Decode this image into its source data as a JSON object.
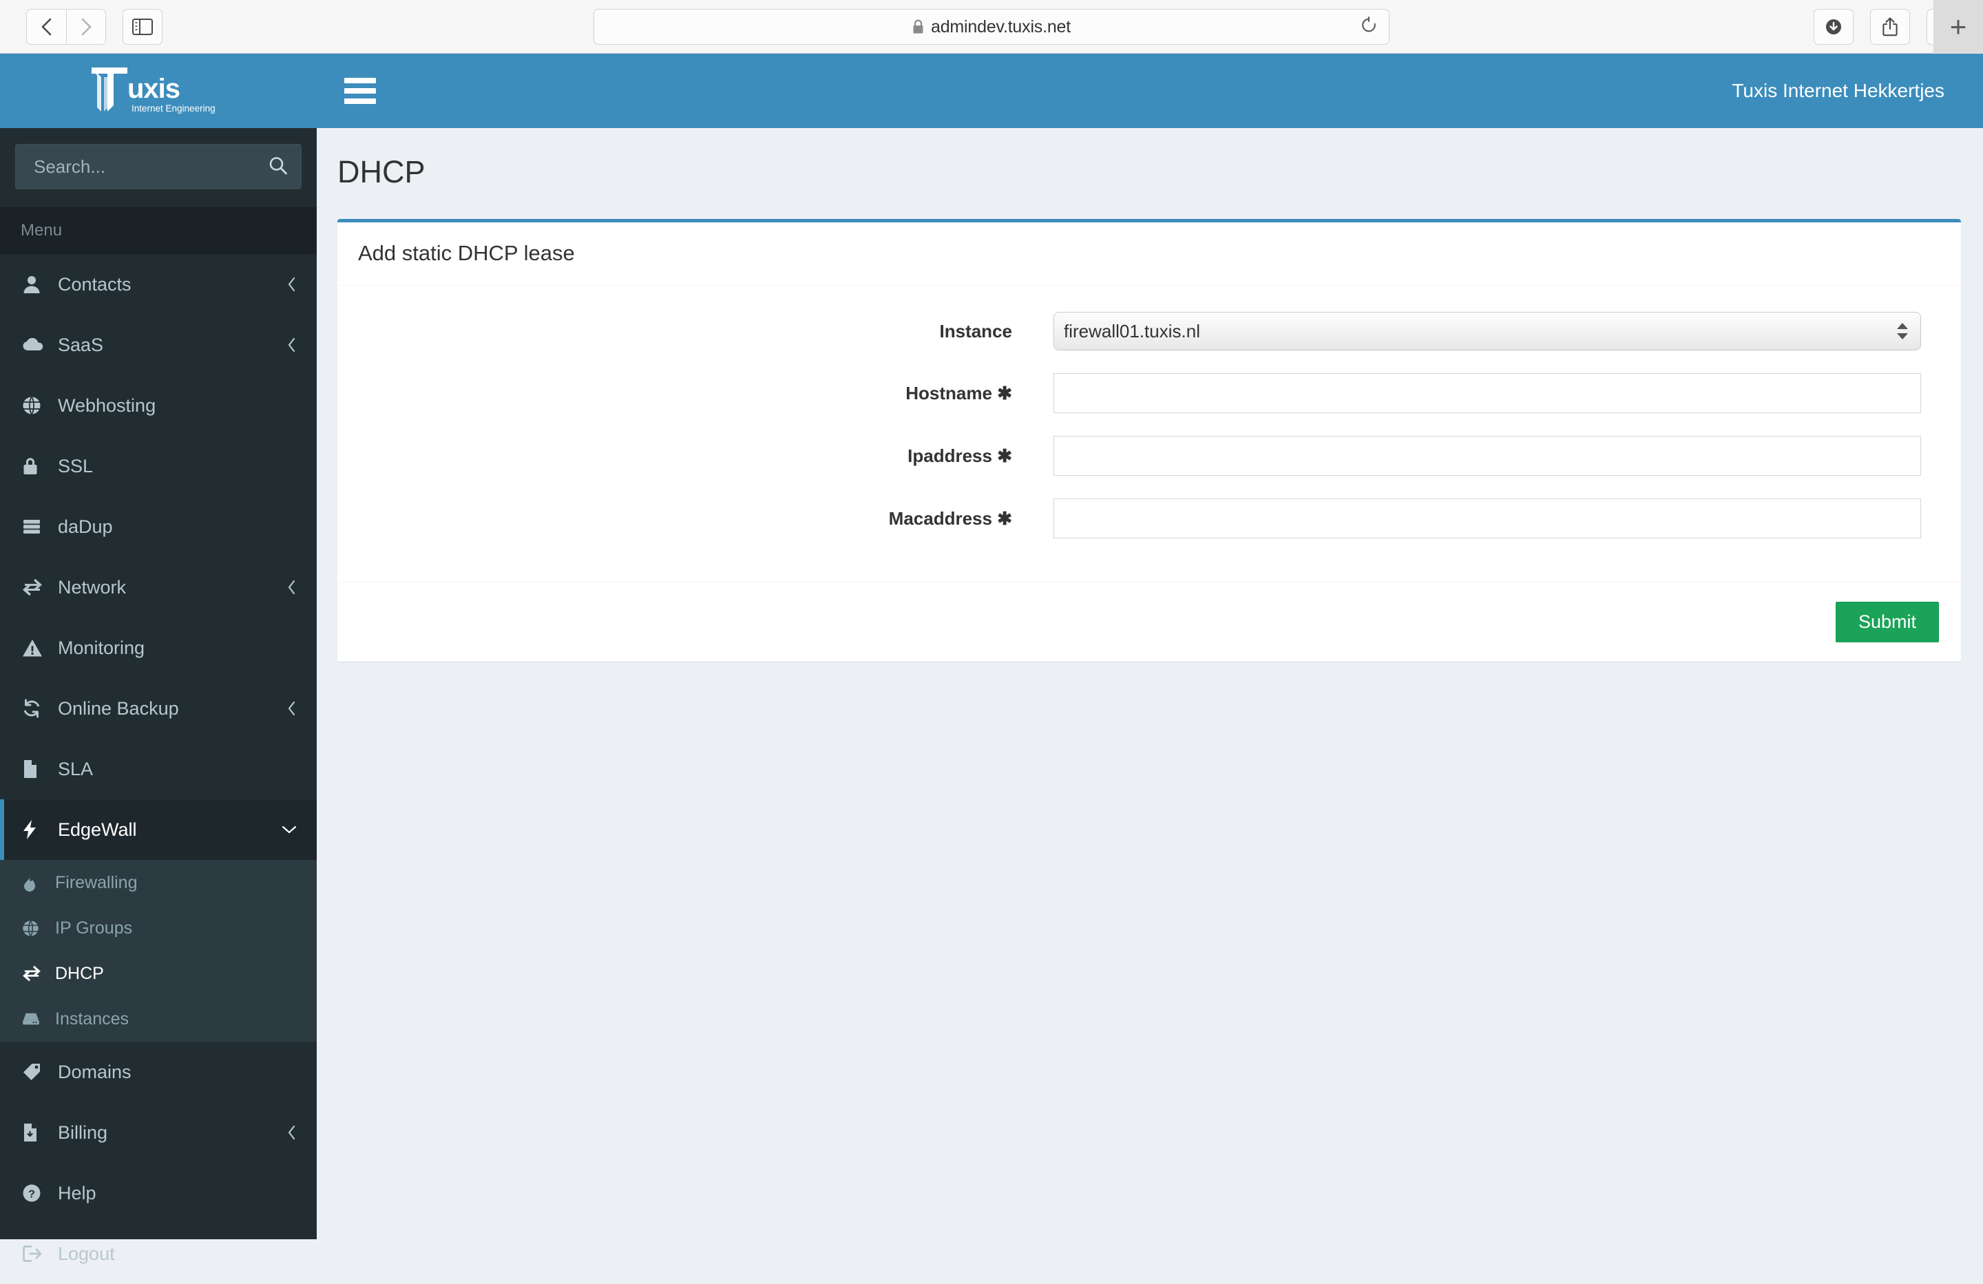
{
  "browser": {
    "url": "admindev.tuxis.net",
    "lock_icon": "lock-icon",
    "back_icon": "chevron-left-icon",
    "forward_icon": "chevron-right-icon",
    "sidebar_toggle_icon": "sidebar-toggle-icon",
    "reload_icon": "reload-icon",
    "downloads_icon": "download-icon",
    "share_icon": "share-icon",
    "tabs_icon": "tab-overview-icon",
    "newtab_label": "+"
  },
  "brand": {
    "name": "Tuxis",
    "tagline": "Internet Engineering",
    "header_color": "#3c8dbc",
    "sidebar_color": "#222d32"
  },
  "topbar": {
    "menu_toggle_icon": "hamburger-icon",
    "user_name": "Tuxis Internet Hekkertjes"
  },
  "sidebar": {
    "search": {
      "placeholder": "Search...",
      "value": "",
      "icon": "search-icon"
    },
    "menu_header": "Menu",
    "items": [
      {
        "label": "Contacts",
        "icon": "user-icon",
        "arrow": "chevron-left-icon",
        "active": false
      },
      {
        "label": "SaaS",
        "icon": "cloud-icon",
        "arrow": "chevron-left-icon",
        "active": false
      },
      {
        "label": "Webhosting",
        "icon": "globe-icon",
        "arrow": "",
        "active": false
      },
      {
        "label": "SSL",
        "icon": "lock-icon",
        "arrow": "",
        "active": false
      },
      {
        "label": "daDup",
        "icon": "server-icon",
        "arrow": "",
        "active": false
      },
      {
        "label": "Network",
        "icon": "exchange-icon",
        "arrow": "chevron-left-icon",
        "active": false
      },
      {
        "label": "Monitoring",
        "icon": "warning-icon",
        "arrow": "",
        "active": false
      },
      {
        "label": "Online Backup",
        "icon": "refresh-icon",
        "arrow": "chevron-left-icon",
        "active": false
      },
      {
        "label": "SLA",
        "icon": "file-icon",
        "arrow": "",
        "active": false
      },
      {
        "label": "EdgeWall",
        "icon": "bolt-icon",
        "arrow": "chevron-down-icon",
        "active": true
      },
      {
        "label": "Domains",
        "icon": "tag-icon",
        "arrow": "",
        "active": false
      },
      {
        "label": "Billing",
        "icon": "file-download-icon",
        "arrow": "chevron-left-icon",
        "active": false
      },
      {
        "label": "Help",
        "icon": "question-circle-icon",
        "arrow": "",
        "active": false
      },
      {
        "label": "Logout",
        "icon": "sign-out-icon",
        "arrow": "",
        "active": false
      }
    ],
    "submenu": [
      {
        "label": "Firewalling",
        "icon": "fire-icon",
        "current": false
      },
      {
        "label": "IP Groups",
        "icon": "globe-icon",
        "current": false
      },
      {
        "label": "DHCP",
        "icon": "exchange-icon",
        "current": true
      },
      {
        "label": "Instances",
        "icon": "server-icon",
        "current": false
      }
    ]
  },
  "main": {
    "page_title": "DHCP",
    "panel": {
      "title": "Add static DHCP lease",
      "accent_color": "#3c8dbc",
      "fields": [
        {
          "label": "Instance",
          "required": false,
          "required_marker": "",
          "type": "select",
          "value": "firewall01.tuxis.nl",
          "options": [
            "firewall01.tuxis.nl"
          ]
        },
        {
          "label": "Hostname",
          "required": true,
          "required_marker": "✱",
          "type": "text",
          "value": "",
          "placeholder": ""
        },
        {
          "label": "Ipaddress",
          "required": true,
          "required_marker": "✱",
          "type": "text",
          "value": "",
          "placeholder": ""
        },
        {
          "label": "Macaddress",
          "required": true,
          "required_marker": "✱",
          "type": "text",
          "value": "",
          "placeholder": ""
        }
      ],
      "submit_label": "Submit",
      "submit_color": "#1ba359"
    }
  }
}
